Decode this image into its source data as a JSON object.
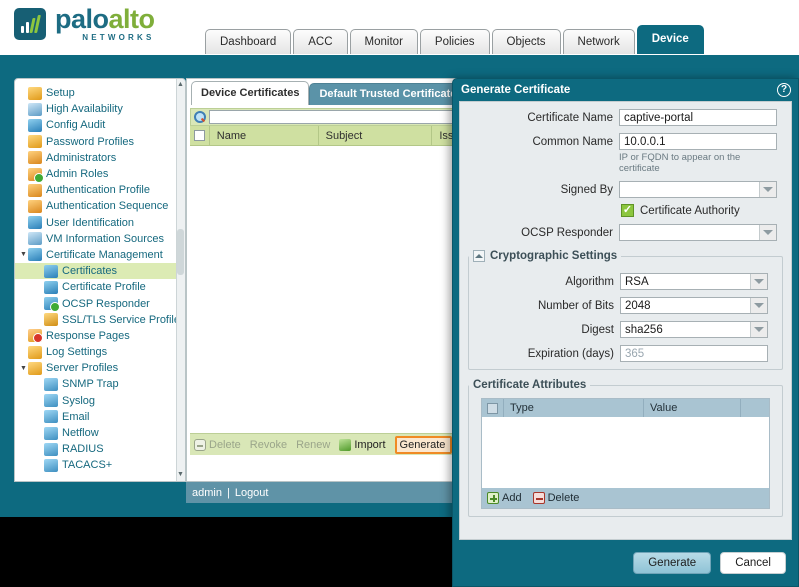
{
  "brand": {
    "name_part1": "palo",
    "name_part2": "alto",
    "tagline": "NETWORKS",
    "logo_icon": "bar-chart-logo-icon"
  },
  "top_tabs": [
    {
      "label": "Dashboard",
      "active": false
    },
    {
      "label": "ACC",
      "active": false
    },
    {
      "label": "Monitor",
      "active": false
    },
    {
      "label": "Policies",
      "active": false
    },
    {
      "label": "Objects",
      "active": false
    },
    {
      "label": "Network",
      "active": false
    },
    {
      "label": "Device",
      "active": true
    }
  ],
  "sidebar": {
    "items": [
      {
        "label": "Setup",
        "indent": 0,
        "icon": "setup-icon",
        "twist": "",
        "selected": false
      },
      {
        "label": "High Availability",
        "indent": 0,
        "icon": "high-availability-icon",
        "twist": "",
        "selected": false
      },
      {
        "label": "Config Audit",
        "indent": 0,
        "icon": "config-audit-icon",
        "twist": "",
        "selected": false
      },
      {
        "label": "Password Profiles",
        "indent": 0,
        "icon": "password-profiles-icon",
        "twist": "",
        "selected": false
      },
      {
        "label": "Administrators",
        "indent": 0,
        "icon": "administrators-icon",
        "twist": "",
        "selected": false
      },
      {
        "label": "Admin Roles",
        "indent": 0,
        "icon": "admin-roles-icon",
        "twist": "",
        "selected": false
      },
      {
        "label": "Authentication Profile",
        "indent": 0,
        "icon": "authentication-profile-icon",
        "twist": "",
        "selected": false
      },
      {
        "label": "Authentication Sequence",
        "indent": 0,
        "icon": "authentication-sequence-icon",
        "twist": "",
        "selected": false
      },
      {
        "label": "User Identification",
        "indent": 0,
        "icon": "user-identification-icon",
        "twist": "",
        "selected": false
      },
      {
        "label": "VM Information Sources",
        "indent": 0,
        "icon": "vm-information-sources-icon",
        "twist": "",
        "selected": false
      },
      {
        "label": "Certificate Management",
        "indent": 0,
        "icon": "certificate-management-icon",
        "twist": "▼",
        "selected": false
      },
      {
        "label": "Certificates",
        "indent": 1,
        "icon": "certificates-icon",
        "twist": "",
        "selected": true
      },
      {
        "label": "Certificate Profile",
        "indent": 1,
        "icon": "certificate-profile-icon",
        "twist": "",
        "selected": false
      },
      {
        "label": "OCSP Responder",
        "indent": 1,
        "icon": "ocsp-responder-icon",
        "twist": "",
        "selected": false
      },
      {
        "label": "SSL/TLS Service Profile",
        "indent": 1,
        "icon": "ssl-tls-service-profile-icon",
        "twist": "",
        "selected": false
      },
      {
        "label": "Response Pages",
        "indent": 0,
        "icon": "response-pages-icon",
        "twist": "",
        "selected": false
      },
      {
        "label": "Log Settings",
        "indent": 0,
        "icon": "log-settings-icon",
        "twist": "",
        "selected": false
      },
      {
        "label": "Server Profiles",
        "indent": 0,
        "icon": "server-profiles-icon",
        "twist": "▼",
        "selected": false
      },
      {
        "label": "SNMP Trap",
        "indent": 1,
        "icon": "snmp-trap-icon",
        "twist": "",
        "selected": false
      },
      {
        "label": "Syslog",
        "indent": 1,
        "icon": "syslog-icon",
        "twist": "",
        "selected": false
      },
      {
        "label": "Email",
        "indent": 1,
        "icon": "email-icon",
        "twist": "",
        "selected": false
      },
      {
        "label": "Netflow",
        "indent": 1,
        "icon": "netflow-icon",
        "twist": "",
        "selected": false
      },
      {
        "label": "RADIUS",
        "indent": 1,
        "icon": "radius-icon",
        "twist": "",
        "selected": false
      },
      {
        "label": "TACACS+",
        "indent": 1,
        "icon": "tacacs-icon",
        "twist": "",
        "selected": false
      }
    ]
  },
  "main": {
    "tabs": [
      {
        "label": "Device Certificates",
        "active": true
      },
      {
        "label": "Default Trusted Certificate Au",
        "active": false
      }
    ],
    "search": {
      "value": "",
      "placeholder": "",
      "icon": "search-icon"
    },
    "table": {
      "columns": [
        "Name",
        "Subject",
        "Iss"
      ],
      "rows": []
    },
    "toolbar": [
      {
        "label": "Delete",
        "icon": "minus-circle-icon",
        "disabled": true,
        "highlight": false
      },
      {
        "label": "Revoke",
        "icon": "",
        "disabled": true,
        "highlight": false
      },
      {
        "label": "Renew",
        "icon": "",
        "disabled": true,
        "highlight": false
      },
      {
        "label": "Import",
        "icon": "import-icon",
        "disabled": false,
        "highlight": false
      },
      {
        "label": "Generate",
        "icon": "generate-icon",
        "disabled": false,
        "highlight": true
      }
    ]
  },
  "status_bar": {
    "user": "admin",
    "separator": "|",
    "logout": "Logout"
  },
  "dialog": {
    "title": "Generate Certificate",
    "help_icon": "help-icon",
    "fields": {
      "certificate_name": {
        "label": "Certificate Name",
        "value": "captive-portal"
      },
      "common_name": {
        "label": "Common Name",
        "value": "10.0.0.1",
        "hint": "IP or FQDN to appear on the certificate"
      },
      "signed_by": {
        "label": "Signed By",
        "value": ""
      },
      "certificate_authority": {
        "label": "Certificate Authority",
        "checked": true
      },
      "ocsp_responder": {
        "label": "OCSP Responder",
        "value": ""
      }
    },
    "crypto_group": {
      "legend": "Cryptographic Settings",
      "algorithm": {
        "label": "Algorithm",
        "value": "RSA"
      },
      "number_of_bits": {
        "label": "Number of Bits",
        "value": "2048"
      },
      "digest": {
        "label": "Digest",
        "value": "sha256"
      },
      "expiration_days": {
        "label": "Expiration (days)",
        "value": "",
        "placeholder": "365"
      }
    },
    "attributes_group": {
      "legend": "Certificate Attributes",
      "columns": [
        "Type",
        "Value"
      ],
      "rows": [],
      "add_label": "Add",
      "delete_label": "Delete"
    },
    "footer": {
      "generate_label": "Generate",
      "cancel_label": "Cancel"
    }
  },
  "colors": {
    "teal": "#0d6a80",
    "green_header": "#cfe0a1",
    "green_row": "#dcebb4",
    "orange_highlight": "#f08a24",
    "attr_blue": "#a9c4d2"
  }
}
